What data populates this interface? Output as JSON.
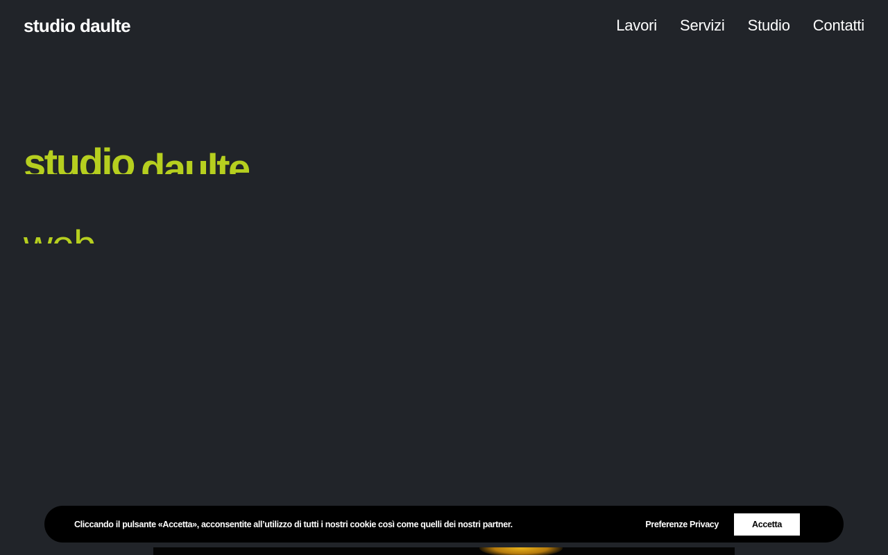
{
  "header": {
    "logo": "studio daulte",
    "nav": [
      {
        "label": "Lavori"
      },
      {
        "label": "Servizi"
      },
      {
        "label": "Studio"
      },
      {
        "label": "Contatti"
      }
    ]
  },
  "hero": {
    "line1_word1": "studio",
    "line1_word2": "daulte",
    "line2_partial": "web"
  },
  "cookie_banner": {
    "text": "Cliccando il pulsante «Accetta», acconsentite all’utilizzo di tutti i nostri cookie così come quelli dei nostri partner.",
    "preferences_label": "Preferenze Privacy",
    "accept_label": "Accetta"
  },
  "colors": {
    "background": "#212429",
    "accent": "#b6cf1f",
    "banner": "#000000"
  }
}
